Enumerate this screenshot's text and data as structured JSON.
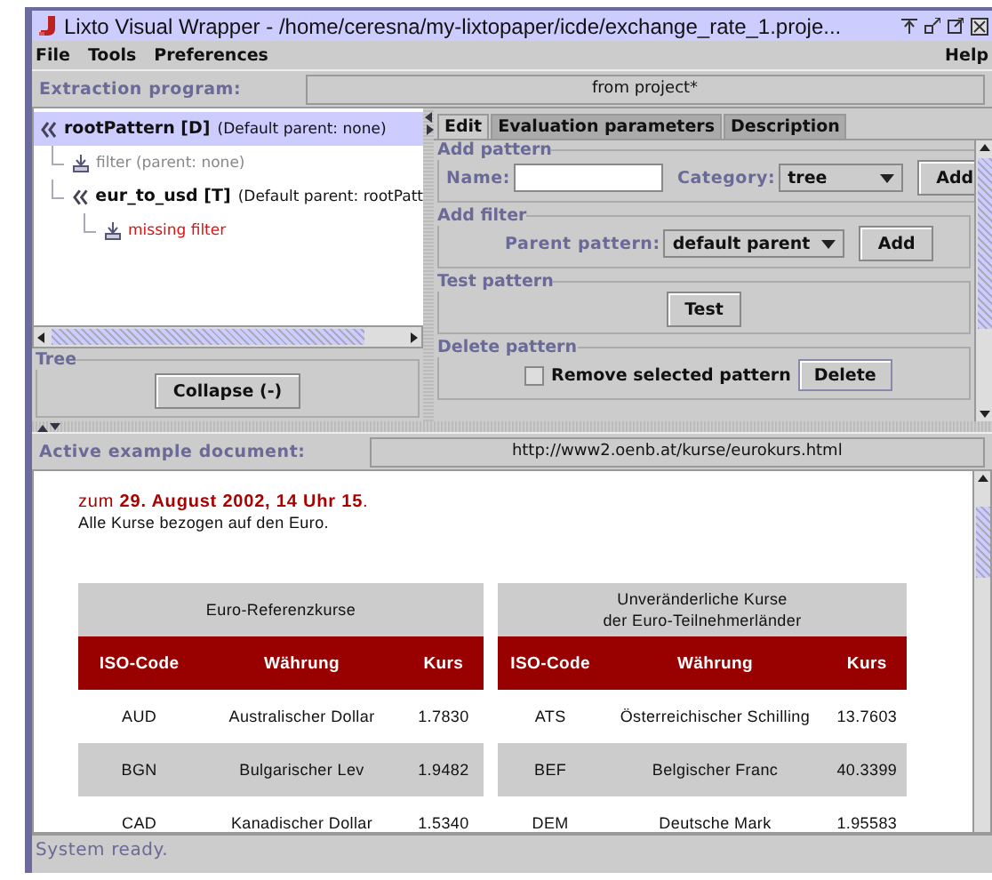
{
  "window": {
    "title": "Lixto Visual Wrapper - /home/ceresna/my-lixtopaper/icde/exchange_rate_1.proje..."
  },
  "menu": [
    {
      "label": "File"
    },
    {
      "label": "Tools"
    },
    {
      "label": "Preferences"
    }
  ],
  "help_menu": {
    "label": "Help"
  },
  "extraction_program": {
    "label": "Extraction program:",
    "value": "from project*"
  },
  "tree": [
    {
      "kind": "pattern",
      "name": "rootPattern [D]",
      "note": "(Default parent: none)",
      "selected": true,
      "children": [
        {
          "kind": "filter",
          "name": "filter (parent: none)",
          "disabled": true,
          "error": false,
          "selected": false
        },
        {
          "kind": "pattern",
          "name": "eur_to_usd [T]",
          "note": "(Default parent: rootPatt",
          "selected": false,
          "children": [
            {
              "kind": "filter",
              "name": "missing filter",
              "disabled": false,
              "error": true,
              "selected": false
            }
          ]
        }
      ]
    }
  ],
  "tree_box": {
    "title": "Tree",
    "button": "Collapse (-)"
  },
  "tabs": [
    {
      "label": "Edit",
      "selected": true
    },
    {
      "label": "Evaluation parameters",
      "selected": false
    },
    {
      "label": "Description",
      "selected": false
    }
  ],
  "add_pattern": {
    "title": "Add pattern",
    "name_label": "Name:",
    "category_label": "Category:",
    "category_value": "tree",
    "button": "Add"
  },
  "add_filter": {
    "title": "Add filter",
    "parent_label": "Parent pattern:",
    "parent_value": "default parent",
    "button": "Add"
  },
  "test_pattern": {
    "title": "Test pattern",
    "button": "Test"
  },
  "delete_pattern": {
    "title": "Delete pattern",
    "checkbox_label": "Remove selected pattern",
    "checked": false,
    "button": "Delete"
  },
  "active_document": {
    "label": "Active example document:",
    "value": "http://www2.oenb.at/kurse/eurokurs.html"
  },
  "document": {
    "heading": "zum **29. August 2002, 14 Uhr 15**.",
    "subline": "Alle Kurse bezogen auf den Euro.",
    "tables": [
      {
        "caption": [
          "Euro-Referenzkurse"
        ],
        "columns": [
          "ISO-Code",
          "Währung",
          "Kurs"
        ],
        "rows": [
          [
            "AUD",
            "Australischer Dollar",
            "1.7830"
          ],
          [
            "BGN",
            "Bulgarischer Lev",
            "1.9482"
          ],
          [
            "CAD",
            "Kanadischer Dollar",
            "1.5340"
          ]
        ]
      },
      {
        "caption": [
          "Unveränderliche Kurse",
          "der Euro-Teilnehmerländer"
        ],
        "columns": [
          "ISO-Code",
          "Währung",
          "Kurs"
        ],
        "rows": [
          [
            "ATS",
            "Österreichischer Schilling",
            "13.7603"
          ],
          [
            "BEF",
            "Belgischer Franc",
            "40.3399"
          ],
          [
            "DEM",
            "Deutsche Mark",
            "1.95583"
          ]
        ]
      }
    ]
  },
  "status_bar": {
    "text": "System ready."
  }
}
